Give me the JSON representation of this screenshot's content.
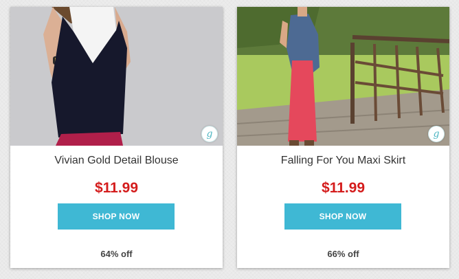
{
  "products": [
    {
      "title": "Vivian Gold Detail Blouse",
      "price": "$11.99",
      "button_label": "SHOP NOW",
      "discount": "64% off",
      "badge_letter": "g"
    },
    {
      "title": "Falling For You Maxi Skirt",
      "price": "$11.99",
      "button_label": "SHOP NOW",
      "discount": "66% off",
      "badge_letter": "g"
    }
  ],
  "colors": {
    "price": "#d41c1c",
    "button": "#3fb8d4",
    "badge": "#4fb7c3"
  }
}
